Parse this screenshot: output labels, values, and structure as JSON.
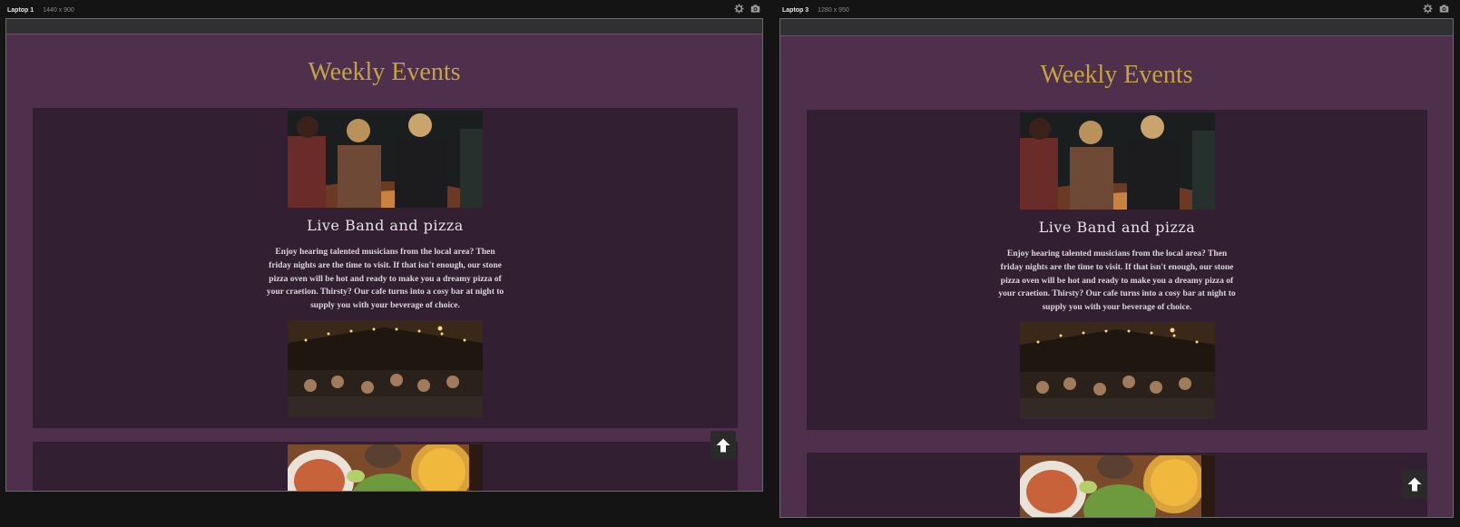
{
  "devices": [
    {
      "name": "Laptop 1",
      "size": "1440 x 900"
    },
    {
      "name": "Laptop 3",
      "size": "1280 x 950"
    }
  ],
  "page": {
    "title": "Weekly Events",
    "event": {
      "title": "Live Band and pizza",
      "description": "Enjoy hearing talented musicians from the local area? Then friday nights are the time to visit. If that isn't enough, our stone pizza oven will be hot and ready to make you a dreamy pizza of your craetion. Thirsty? Our cafe turns into a cosy bar at night to supply you with your beverage of choice."
    }
  },
  "icons": {
    "settings": "gear-icon",
    "screenshot": "camera-icon",
    "scroll_top": "arrow-up-icon"
  },
  "colors": {
    "app_background": "#141414",
    "page_background": "#4e2f4c",
    "card_background": "#331f32",
    "heading_gold": "#c4a344",
    "text_light": "#e6e2e6"
  }
}
